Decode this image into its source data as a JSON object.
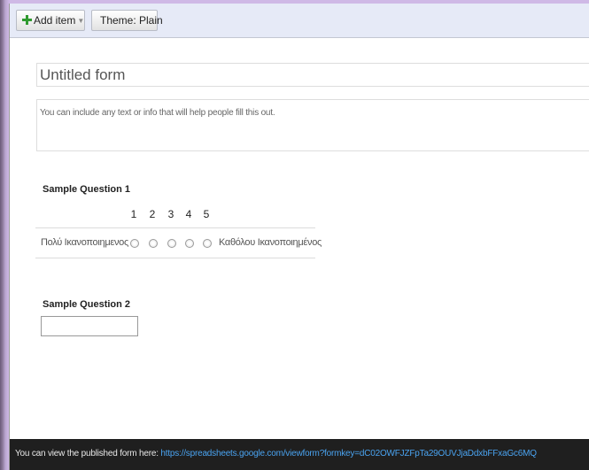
{
  "toolbar": {
    "add_item_label": "Add item",
    "theme_label": "Theme: Plain"
  },
  "form": {
    "title": "Untitled form",
    "description": "You can include any text or info that will help people fill this out."
  },
  "questions": [
    {
      "title": "Sample Question 1",
      "type": "scale",
      "scale_numbers": [
        "1",
        "2",
        "3",
        "4",
        "5"
      ],
      "low_label": "Πολύ Ικανοποιημενος",
      "high_label": "Καθόλου Ικανοποιημένος"
    },
    {
      "title": "Sample Question 2",
      "type": "text",
      "value": ""
    }
  ],
  "footer": {
    "prefix": "You can view the published form here:",
    "url": "https://spreadsheets.google.com/viewform?formkey=dC02OWFJZFpTa29OUVJjaDdxbFFxaGc6MQ"
  },
  "icons": {
    "add": "plus-icon",
    "dropdown": "caret-down-icon"
  },
  "colors": {
    "background": "#cfb9e6",
    "toolbar": "#e6eaf7",
    "add_icon": "#2f9a2f",
    "footer_bg": "#1f1f1f",
    "link": "#4aa3f0"
  }
}
